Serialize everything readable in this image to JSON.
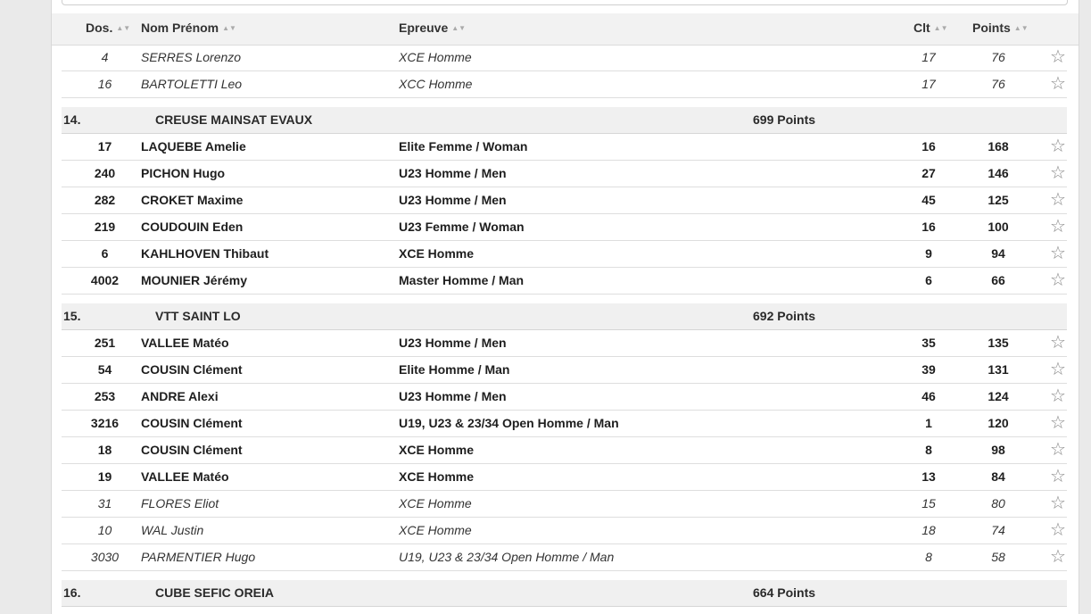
{
  "table": {
    "headers": {
      "dos": "Dos.",
      "nom": "Nom Prénom",
      "epreuve": "Epreuve",
      "clt": "Clt",
      "points": "Points"
    }
  },
  "icons": {
    "sort": "sort-icon",
    "star": "star-outline-icon"
  },
  "glyphs": {
    "sort": "▲▼",
    "star": "☆"
  },
  "groups": [
    {
      "rank": "",
      "club": "",
      "points": "",
      "rows": [
        {
          "dos": "4",
          "nom": "SERRES Lorenzo",
          "epreuve": "XCE Homme",
          "clt": "17",
          "points": "76",
          "style": "italic"
        },
        {
          "dos": "16",
          "nom": "BARTOLETTI Leo",
          "epreuve": "XCC Homme",
          "clt": "17",
          "points": "76",
          "style": "italic"
        }
      ]
    },
    {
      "rank": "14.",
      "club": "CREUSE MAINSAT EVAUX",
      "points": "699 Points",
      "rows": [
        {
          "dos": "17",
          "nom": "LAQUEBE Amelie",
          "epreuve": "Elite Femme / Woman",
          "clt": "16",
          "points": "168",
          "style": "bold"
        },
        {
          "dos": "240",
          "nom": "PICHON Hugo",
          "epreuve": "U23 Homme / Men",
          "clt": "27",
          "points": "146",
          "style": "bold"
        },
        {
          "dos": "282",
          "nom": "CROKET Maxime",
          "epreuve": "U23 Homme / Men",
          "clt": "45",
          "points": "125",
          "style": "bold"
        },
        {
          "dos": "219",
          "nom": "COUDOUIN Eden",
          "epreuve": "U23 Femme / Woman",
          "clt": "16",
          "points": "100",
          "style": "bold"
        },
        {
          "dos": "6",
          "nom": "KAHLHOVEN Thibaut",
          "epreuve": "XCE Homme",
          "clt": "9",
          "points": "94",
          "style": "bold"
        },
        {
          "dos": "4002",
          "nom": "MOUNIER Jérémy",
          "epreuve": "Master Homme / Man",
          "clt": "6",
          "points": "66",
          "style": "bold"
        }
      ]
    },
    {
      "rank": "15.",
      "club": "VTT SAINT LO",
      "points": "692 Points",
      "rows": [
        {
          "dos": "251",
          "nom": "VALLEE Matéo",
          "epreuve": "U23 Homme / Men",
          "clt": "35",
          "points": "135",
          "style": "bold"
        },
        {
          "dos": "54",
          "nom": "COUSIN Clément",
          "epreuve": "Elite Homme / Man",
          "clt": "39",
          "points": "131",
          "style": "bold"
        },
        {
          "dos": "253",
          "nom": "ANDRE Alexi",
          "epreuve": "U23 Homme / Men",
          "clt": "46",
          "points": "124",
          "style": "bold"
        },
        {
          "dos": "3216",
          "nom": "COUSIN Clément",
          "epreuve": "U19, U23 & 23/34 Open Homme / Man",
          "clt": "1",
          "points": "120",
          "style": "bold"
        },
        {
          "dos": "18",
          "nom": "COUSIN Clément",
          "epreuve": "XCE Homme",
          "clt": "8",
          "points": "98",
          "style": "bold"
        },
        {
          "dos": "19",
          "nom": "VALLEE Matéo",
          "epreuve": "XCE Homme",
          "clt": "13",
          "points": "84",
          "style": "bold"
        },
        {
          "dos": "31",
          "nom": "FLORES Eliot",
          "epreuve": "XCE Homme",
          "clt": "15",
          "points": "80",
          "style": "italic"
        },
        {
          "dos": "10",
          "nom": "WAL Justin",
          "epreuve": "XCE Homme",
          "clt": "18",
          "points": "74",
          "style": "italic"
        },
        {
          "dos": "3030",
          "nom": "PARMENTIER Hugo",
          "epreuve": "U19, U23 & 23/34 Open Homme / Man",
          "clt": "8",
          "points": "58",
          "style": "italic"
        }
      ]
    },
    {
      "rank": "16.",
      "club": "CUBE SEFIC OREIA",
      "points": "664 Points",
      "rows": []
    }
  ]
}
